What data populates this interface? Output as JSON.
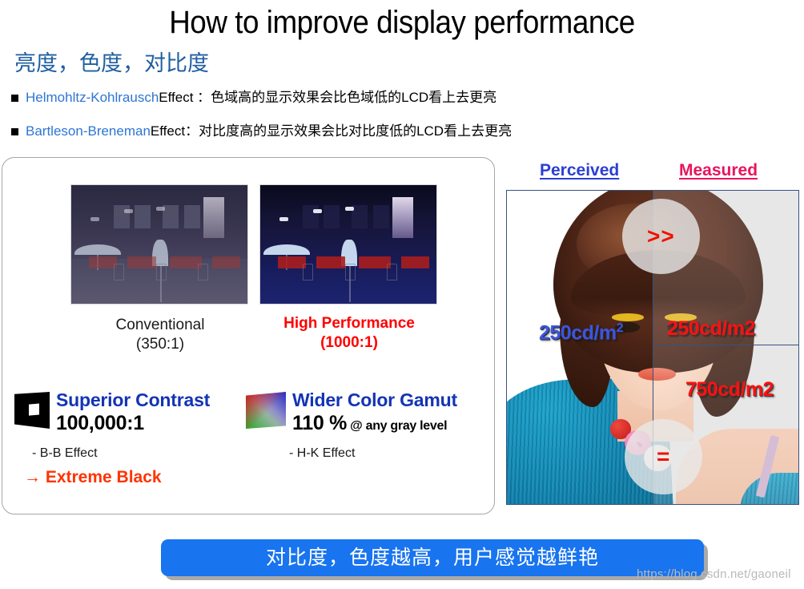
{
  "title": "How to improve display performance",
  "subheading": "亮度，色度，对比度",
  "bullets": [
    {
      "name": "Helmohltz-Kohlrausch",
      "rest": " Effect ：色域高的显示效果会比色域低的LCD看上去更亮"
    },
    {
      "name": "Bartleson-Breneman",
      "rest": " Effect：对比度高的显示效果会比对比度低的LCD看上去更亮"
    }
  ],
  "left_panel": {
    "photos": [
      {
        "caption_line1": "Conventional",
        "caption_line2": "(350:1)",
        "variant": "conventional"
      },
      {
        "caption_line1": "High Performance",
        "caption_line2": "(1000:1)",
        "variant": "high-performance"
      }
    ],
    "features": [
      {
        "icon": "contrast-screen-icon",
        "title": "Superior Contrast",
        "value": "100,000:1",
        "value_suffix": "",
        "sub": "- B-B Effect",
        "arrow": "→ Extreme Black"
      },
      {
        "icon": "color-gamut-icon",
        "title": "Wider Color Gamut",
        "value": "110 %",
        "value_suffix": " @ any gray level",
        "sub": "- H-K Effect",
        "arrow": ""
      }
    ]
  },
  "right_panel": {
    "header_perceived": "Perceived",
    "header_measured": "Measured",
    "symbol_greater": ">>",
    "symbol_equal": "=",
    "label_perceived": "250cd/m",
    "label_perceived_sup": "2",
    "label_measured_top": "250cd/m2",
    "label_measured_bottom": "750cd/m2"
  },
  "banner": {
    "text": "对比度，色度越高，用户感觉越鲜艳"
  },
  "watermark": "https://blog.csdn.net/gaoneil",
  "colors": {
    "title": "#000000",
    "subheading": "#1F5FA0",
    "bullet_name": "#2E75D4",
    "feature_title": "#1434B4",
    "extreme_black": "#FF3300",
    "high_performance": "#FF0000",
    "perceived": "#2B3FD4",
    "measured": "#E8145E",
    "cd_perceived": "#3B55E0",
    "cd_measured": "#FF1111",
    "banner_bg": "#1874EF",
    "banner_text": "#FFFFFF",
    "panel_border": "#A6A6A6",
    "photo_border": "#36537D"
  }
}
